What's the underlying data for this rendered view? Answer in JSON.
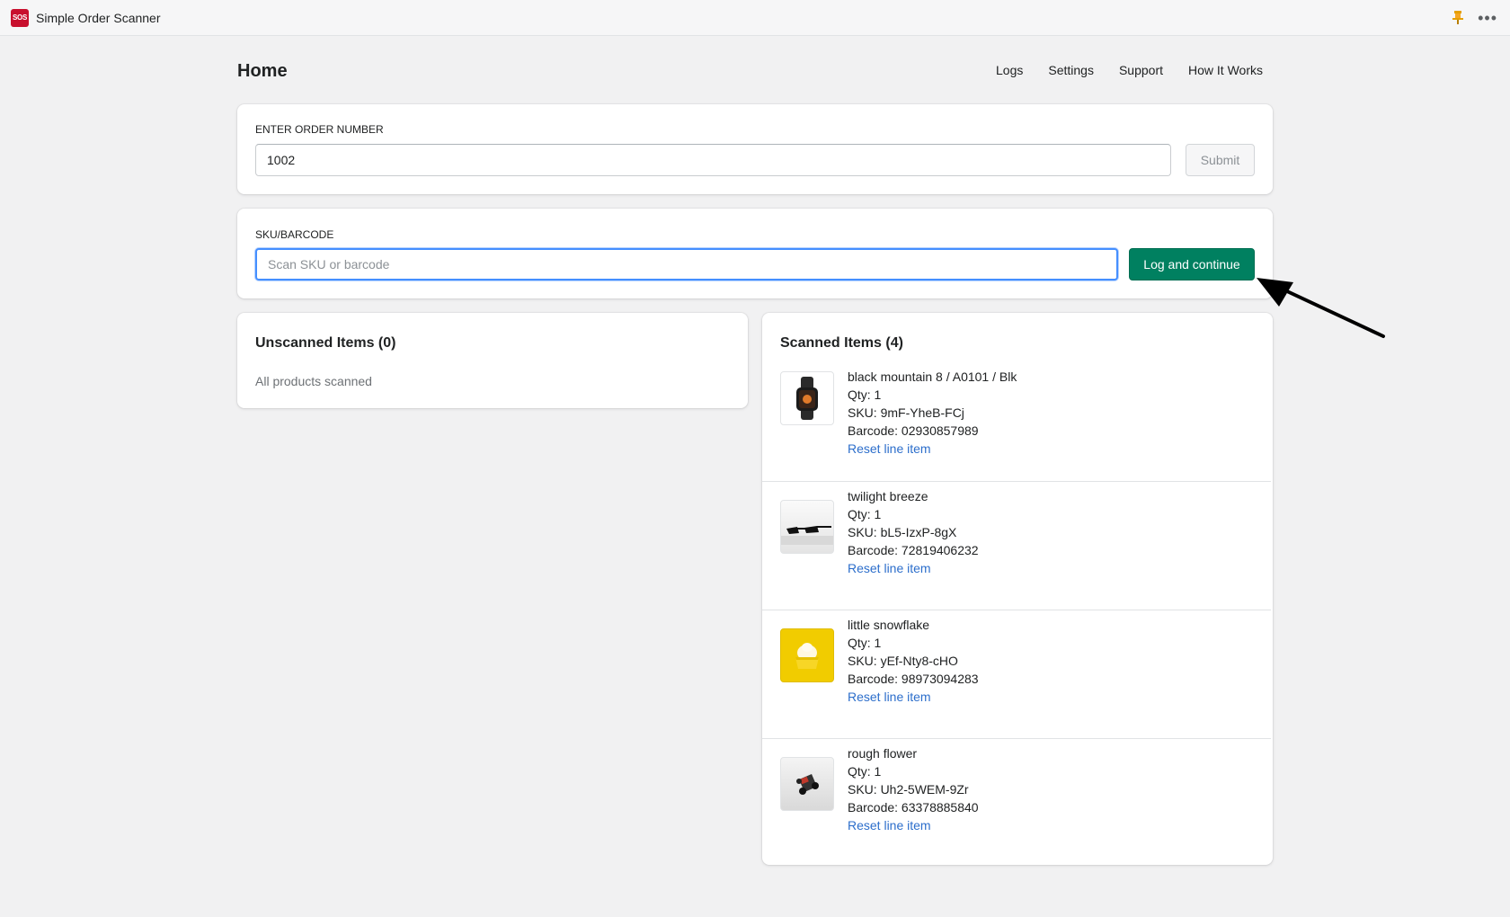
{
  "app": {
    "logo_text": "SOS",
    "title": "Simple Order Scanner",
    "icons": [
      "pin-icon",
      "more-icon"
    ],
    "more_glyph": "•••"
  },
  "header": {
    "title": "Home",
    "nav": [
      "Logs",
      "Settings",
      "Support",
      "How It Works"
    ]
  },
  "order_form": {
    "label": "ENTER ORDER NUMBER",
    "value": "1002",
    "submit_label": "Submit"
  },
  "sku_form": {
    "label": "SKU/BARCODE",
    "placeholder": "Scan SKU or barcode",
    "value": "",
    "button_label": "Log and continue"
  },
  "unscanned": {
    "heading": "Unscanned Items (0)",
    "empty_text": "All products scanned"
  },
  "scanned": {
    "heading": "Scanned Items (4)",
    "items": [
      {
        "name": "black mountain 8 / A0101 / Blk",
        "qty": "Qty: 1",
        "sku": "SKU: 9mF-YheB-FCj",
        "barcode": "Barcode: 02930857989",
        "action": "Reset line item",
        "thumb": "smartwatch-image"
      },
      {
        "name": "twilight breeze",
        "qty": "Qty: 1",
        "sku": "SKU: bL5-IzxP-8gX",
        "barcode": "Barcode: 72819406232",
        "action": "Reset line item",
        "thumb": "sunglasses-image"
      },
      {
        "name": "little snowflake",
        "qty": "Qty: 1",
        "sku": "SKU: yEf-Nty8-cHO",
        "barcode": "Barcode: 98973094283",
        "action": "Reset line item",
        "thumb": "cupcake-image"
      },
      {
        "name": "rough flower",
        "qty": "Qty: 1",
        "sku": "SKU: Uh2-5WEM-9Zr",
        "barcode": "Barcode: 63378885840",
        "action": "Reset line item",
        "thumb": "toy-car-image"
      }
    ]
  },
  "colors": {
    "primary": "#008060",
    "link": "#2c6ecb",
    "focus": "#458fff",
    "logo": "#c8102e"
  }
}
